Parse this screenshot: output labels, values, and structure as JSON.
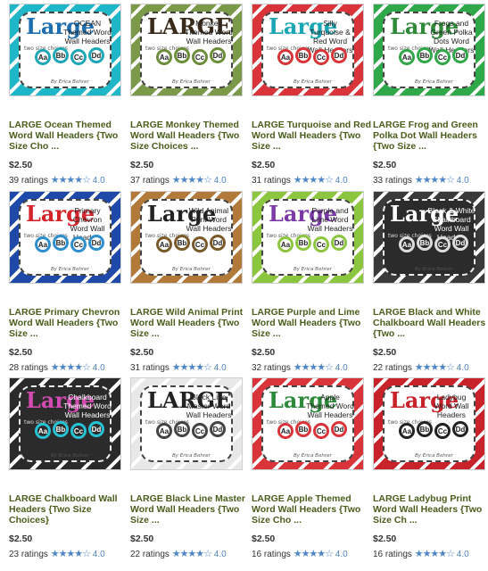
{
  "author_credit": "By Erica Bohrer",
  "choices_text": "two size choices",
  "products": [
    {
      "title": "LARGE Ocean Themed Word Wall Headers {Two Size Cho ...",
      "price": "$2.50",
      "ratings": "39 ratings",
      "score": "4.0",
      "stars": "★★★★☆",
      "thumb_big": "Large",
      "thumb_sub": "OCEAN Themed Word Wall Headers",
      "theme_bg": "#1fb6c7",
      "big_color": "#1f6fb0",
      "circle_color": "#1fa6b7"
    },
    {
      "title": "LARGE Monkey Themed Word Wall Headers {Two Size Choices ...",
      "price": "$2.50",
      "ratings": "37 ratings",
      "score": "4.0",
      "stars": "★★★★☆",
      "thumb_big": "LARGE",
      "thumb_sub": "Monkey Themed Word Wall Headers",
      "theme_bg": "#7a9a4a",
      "big_color": "#3a2a1a",
      "circle_color": "#6b8e3a"
    },
    {
      "title": "LARGE Turquoise and Red Word Wall Headers {Two Size ...",
      "price": "$2.50",
      "ratings": "31 ratings",
      "score": "4.0",
      "stars": "★★★★☆",
      "thumb_big": "Large",
      "thumb_sub": "Silly Turquoise & Red Word Wall Headers",
      "theme_bg": "#d9343a",
      "big_color": "#1aa6b5",
      "circle_color": "#d9343a"
    },
    {
      "title": "LARGE Frog and Green Polka Dot Wall Headers {Two Size ...",
      "price": "$2.50",
      "ratings": "33 ratings",
      "score": "4.0",
      "stars": "★★★★☆",
      "thumb_big": "Large",
      "thumb_sub": "Frogs and Green Polka Dots Word Wall Headers",
      "theme_bg": "#2fa84a",
      "big_color": "#2f8a3a",
      "circle_color": "#2fa84a"
    },
    {
      "title": "LARGE Primary Chevron Word Wall Headers {Two Size ...",
      "price": "$2.50",
      "ratings": "28 ratings",
      "score": "4.0",
      "stars": "★★★★☆",
      "thumb_big": "Large",
      "thumb_sub": "Primary Chevron Word Wall Headers",
      "theme_bg": "#1e49a8",
      "big_color": "#d3252b",
      "circle_color": "#2e8fd0"
    },
    {
      "title": "LARGE Wild Animal Print Word Wall Headers {Two Size ...",
      "price": "$2.50",
      "ratings": "31 ratings",
      "score": "4.0",
      "stars": "★★★★☆",
      "thumb_big": "Large",
      "thumb_sub": "Wild Animal Print Word Wall Headers",
      "theme_bg": "#b27a3a",
      "big_color": "#222222",
      "circle_color": "#7a5a2a"
    },
    {
      "title": "LARGE Purple and Lime Word Wall Headers {Two Size ...",
      "price": "$2.50",
      "ratings": "32 ratings",
      "score": "4.0",
      "stars": "★★★★☆",
      "thumb_big": "Large",
      "thumb_sub": "Purple and Lime Word Wall Headers",
      "theme_bg": "#8cc63f",
      "big_color": "#7b3aa6",
      "circle_color": "#8cc63f"
    },
    {
      "title": "LARGE Black and White Chalkboard Wall Headers {Two ...",
      "price": "$2.50",
      "ratings": "22 ratings",
      "score": "4.0",
      "stars": "★★★★☆",
      "thumb_big": "Large",
      "thumb_sub": "Black & White Chalkboard Word Wall Headers",
      "theme_bg": "#3a3a3a",
      "big_color": "#ffffff",
      "circle_color": "#dddddd",
      "dark": true
    },
    {
      "title": "LARGE Chalkboard Wall Headers {Two Size Choices}",
      "price": "$2.50",
      "ratings": "23 ratings",
      "score": "4.0",
      "stars": "★★★★☆",
      "thumb_big": "Large",
      "thumb_sub": "Chalkboard Themed Word Wall Headers",
      "theme_bg": "#2a2a2a",
      "big_color": "#d14bb0",
      "circle_color": "#27c2d6",
      "dark": true
    },
    {
      "title": "LARGE Black Line Master Word Wall Headers {Two Size ...",
      "price": "$2.50",
      "ratings": "22 ratings",
      "score": "4.0",
      "stars": "★★★★☆",
      "thumb_big": "LARGE",
      "thumb_sub": "Black Line Master Word Wall Headers",
      "theme_bg": "#e8e8e8",
      "big_color": "#222222",
      "circle_color": "#444444"
    },
    {
      "title": "LARGE Apple Themed Word Wall Headers {Two Size Cho ...",
      "price": "$2.50",
      "ratings": "16 ratings",
      "score": "4.0",
      "stars": "★★★★☆",
      "thumb_big": "Large",
      "thumb_sub": "Apple Themed Word Wall Headers",
      "theme_bg": "#d9343a",
      "big_color": "#2c8a3a",
      "circle_color": "#d9343a"
    },
    {
      "title": "LARGE Ladybug Print Word Wall Headers {Two Size Ch ...",
      "price": "$2.50",
      "ratings": "16 ratings",
      "score": "4.0",
      "stars": "★★★★☆",
      "thumb_big": "Large",
      "thumb_sub": "Ladybug Word Wall Headers",
      "theme_bg": "#c8232b",
      "big_color": "#c8232b",
      "circle_color": "#222222"
    }
  ]
}
